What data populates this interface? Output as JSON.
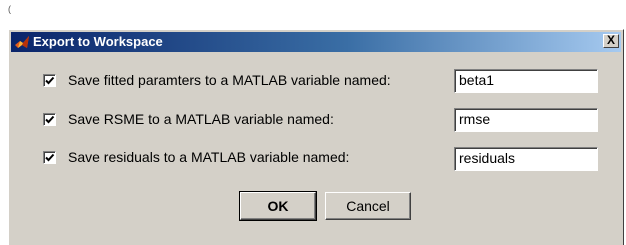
{
  "stray_mark": "(",
  "dialog": {
    "title": "Export to Workspace",
    "title_icon": "matlab-logo-icon",
    "close_label": "X"
  },
  "rows": [
    {
      "checked": true,
      "label": "Save fitted paramters to a MATLAB variable named:",
      "value": "beta1"
    },
    {
      "checked": true,
      "label": "Save RSME to a MATLAB variable named:",
      "value": "rmse"
    },
    {
      "checked": true,
      "label": "Save residuals to a MATLAB variable named:",
      "value": "residuals"
    }
  ],
  "buttons": {
    "ok_label": "OK",
    "cancel_label": "Cancel"
  }
}
